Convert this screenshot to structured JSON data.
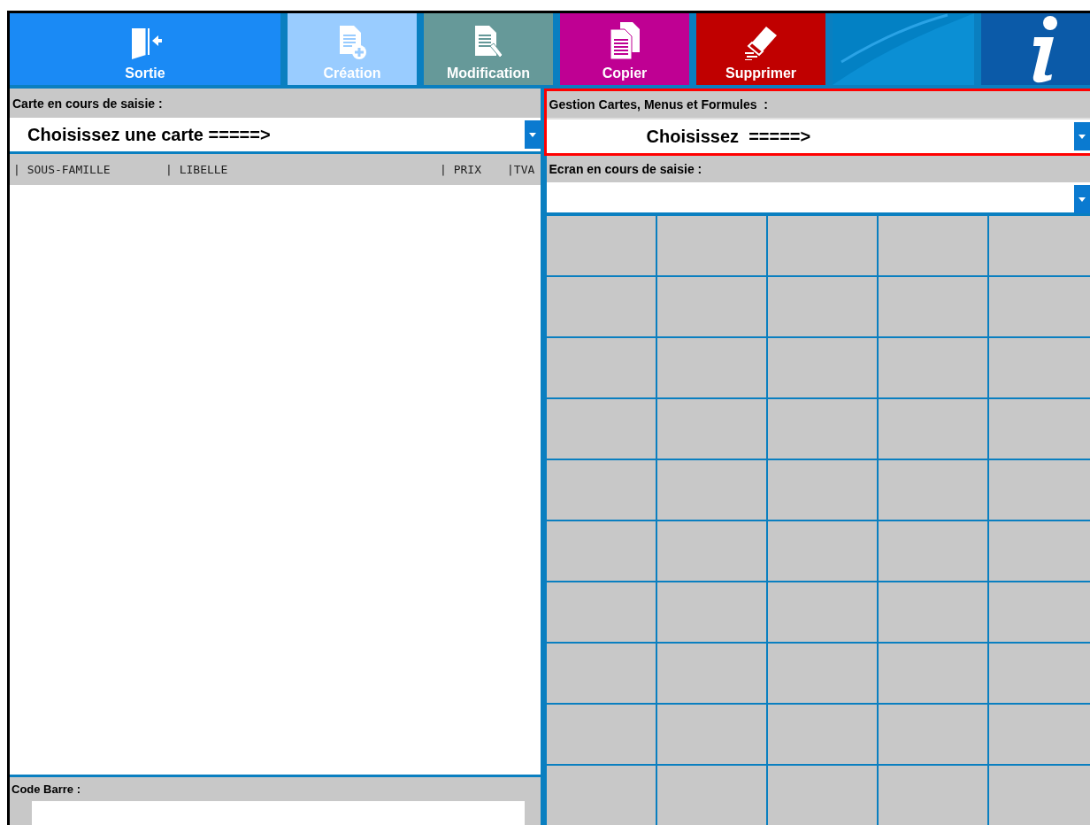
{
  "toolbar": {
    "buttons": [
      {
        "label": "Sortie",
        "kind": "exit",
        "color": "#1a8af5"
      },
      {
        "label": "Création",
        "kind": "create",
        "color": "#99ccff"
      },
      {
        "label": "Modification",
        "kind": "edit",
        "color": "#669999"
      },
      {
        "label": "Copier",
        "kind": "copy",
        "color": "#bf0093"
      },
      {
        "label": "Supprimer",
        "kind": "delete",
        "color": "#c00000"
      }
    ]
  },
  "card_panel": {
    "label": "Carte en cours de saisie :",
    "select": {
      "value": "Choisissez une carte =====>"
    },
    "columns": [
      "| SOUS-FAMILLE",
      "| LIBELLE",
      "| PRIX",
      "|TVA"
    ],
    "barcode": {
      "label": "Code Barre :"
    }
  },
  "management_panel": {
    "label": "Gestion Cartes, Menus et Formules  :",
    "select": {
      "value": "Choisissez  =====>"
    },
    "screen": {
      "label": "Ecran en cours de saisie :"
    }
  }
}
